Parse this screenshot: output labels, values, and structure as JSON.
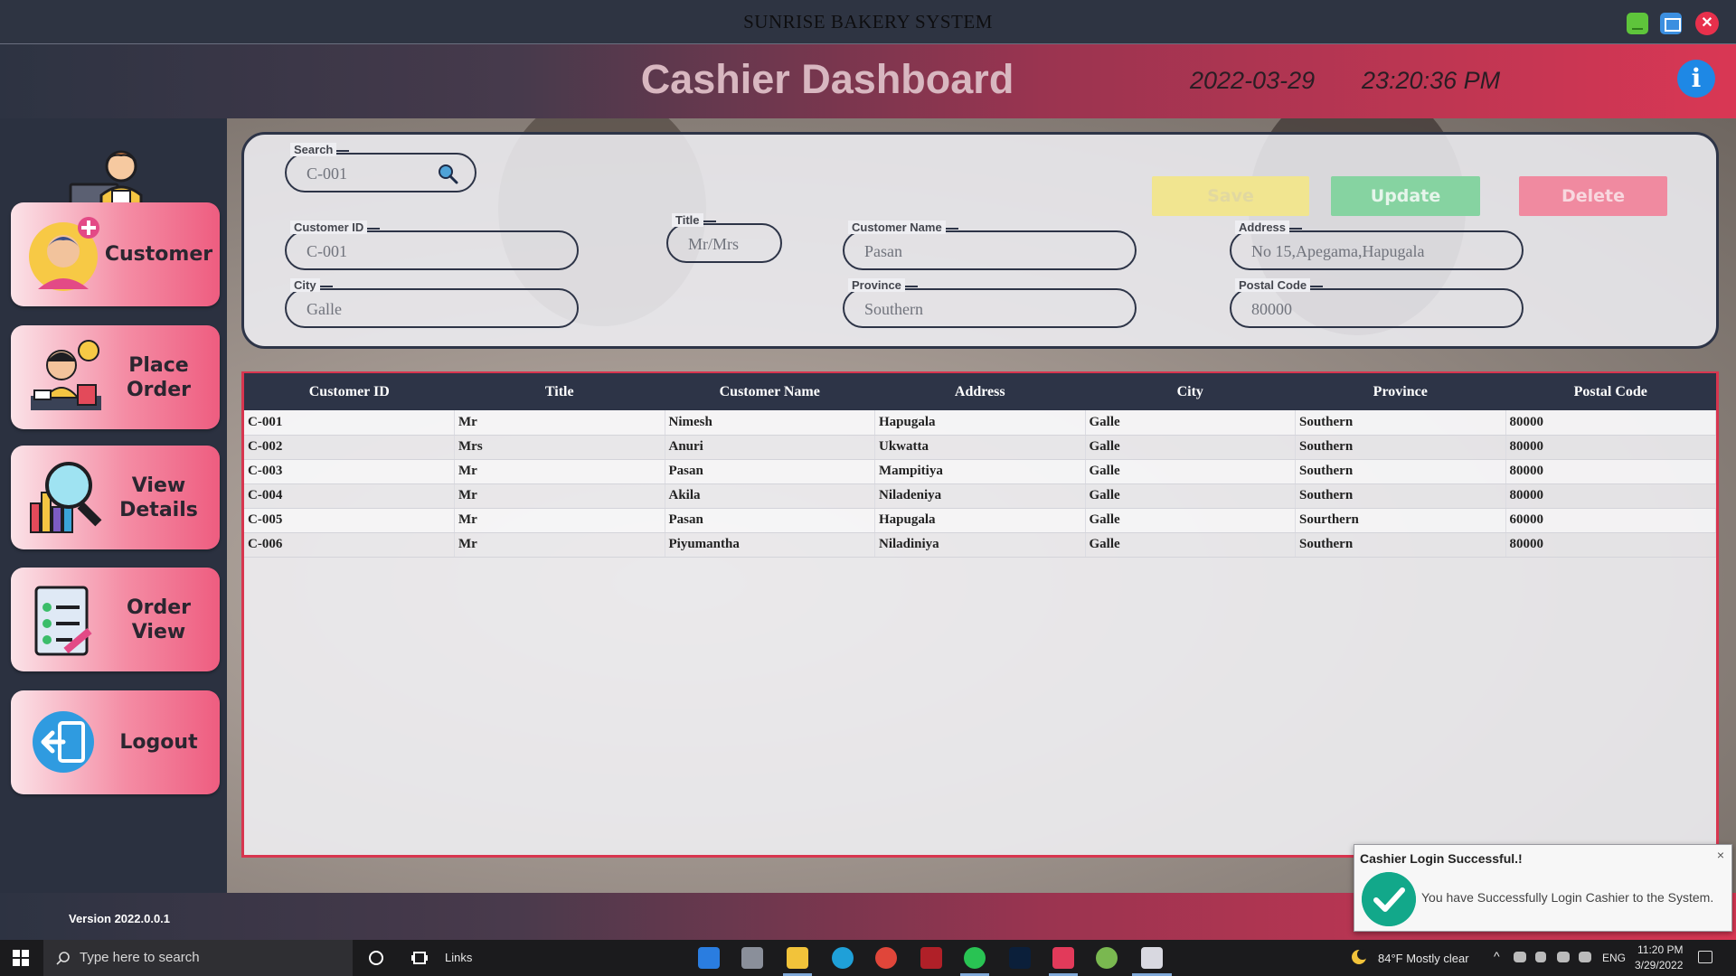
{
  "window": {
    "title": "SUNRISE BAKERY SYSTEM",
    "min_icon": "minimize-icon",
    "max_icon": "maximize-icon",
    "close_icon": "close-icon",
    "close_glyph": "✕"
  },
  "header": {
    "title": "Cashier Dashboard",
    "date": "2022-03-29",
    "time": "23:20:36 PM",
    "info_glyph": "i"
  },
  "sidebar": {
    "items": [
      {
        "label": "Customer",
        "icon": "customer-icon"
      },
      {
        "label": "Place\nOrder",
        "icon": "place-order-icon"
      },
      {
        "label": "View\nDetails",
        "icon": "view-details-icon"
      },
      {
        "label": "Order\nView",
        "icon": "order-view-icon"
      },
      {
        "label": "Logout",
        "icon": "logout-icon"
      }
    ],
    "version": "Version 2022.0.0.1"
  },
  "form": {
    "search": {
      "label": "Search",
      "value": "C-001"
    },
    "title": {
      "label": "Title",
      "value": "Mr/Mrs"
    },
    "customer_id": {
      "label": "Customer ID",
      "value": "C-001"
    },
    "customer_name": {
      "label": "Customer Name",
      "value": "Pasan"
    },
    "address": {
      "label": "Address",
      "value": "No 15,Apegama,Hapugala"
    },
    "city": {
      "label": "City",
      "value": "Galle"
    },
    "province": {
      "label": "Province",
      "value": "Southern"
    },
    "postal_code": {
      "label": "Postal Code",
      "value": "80000"
    },
    "buttons": {
      "save": "Save",
      "update": "Update",
      "delete": "Delete"
    }
  },
  "table": {
    "columns": [
      "Customer ID",
      "Title",
      "Customer Name",
      "Address",
      "City",
      "Province",
      "Postal Code"
    ],
    "rows": [
      [
        "C-001",
        "Mr",
        "Nimesh",
        "Hapugala",
        "Galle",
        "Southern",
        "80000"
      ],
      [
        "C-002",
        "Mrs",
        "Anuri",
        "Ukwatta",
        "Galle",
        "Southern",
        "80000"
      ],
      [
        "C-003",
        "Mr",
        "Pasan",
        "Mampitiya",
        "Galle",
        "Southern",
        "80000"
      ],
      [
        "C-004",
        "Mr",
        "Akila",
        "Niladeniya",
        "Galle",
        "Southern",
        "80000"
      ],
      [
        "C-005",
        "Mr",
        "Pasan",
        "Hapugala",
        "Galle",
        "Sourthern",
        "60000"
      ],
      [
        "C-006",
        "Mr",
        "Piyumantha",
        "Niladiniya",
        "Galle",
        "Southern",
        "80000"
      ]
    ]
  },
  "toast": {
    "title": "Cashier Login Successful.!",
    "message": "You have Successfully Login Cashier to the System.",
    "close_glyph": "×"
  },
  "taskbar": {
    "search_placeholder": "Type here to search",
    "links": "Links",
    "weather": "84°F  Mostly clear",
    "language": "ENG",
    "time": "11:20 PM",
    "date": "3/29/2022",
    "apps": [
      "mail-icon",
      "explorer-cabinet-icon",
      "file-explorer-icon",
      "edge-icon",
      "chrome-icon",
      "media-icon",
      "whatsapp-icon",
      "photoshop-icon",
      "intellij-icon",
      "app-icon",
      "java-app-icon"
    ]
  },
  "colors": {
    "accent": "#d93754",
    "navy": "#2d3447",
    "save": "#f1e590",
    "update": "#86d3a1",
    "delete": "#f08aa0"
  }
}
